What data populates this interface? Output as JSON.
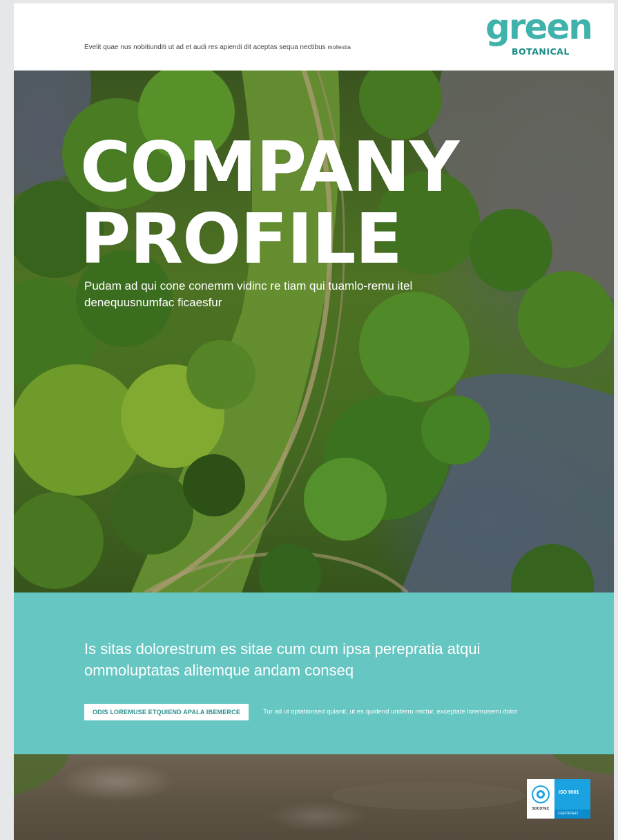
{
  "header": {
    "tagline_main": "Evelit quae nus nobitiunditi ut ad et audi res apiendi dit aceptas sequa nectibus",
    "tagline_small": "mollestia",
    "logo_word": "green",
    "logo_sub": "BOTANICAL"
  },
  "hero": {
    "title_line1": "COMPANY",
    "title_line2": "PROFILE",
    "subtitle": "Pudam ad qui cone conemm vidinc re tiam qui tuamlo-remu itel denequusnumfac ficaesfur"
  },
  "band": {
    "text": "Is sitas dolorestrum es sitae cum cum ipsa perepratia atqui ommoluptatas alitemque andam conseq",
    "button_label": "ODIS LOREMUSE ETQUIEND APALA IBEMERCE",
    "note": "Tur ad ut optationsed quianit, ut es quidend underro reictur, exceptate loremusemi dolor"
  },
  "certification": {
    "standard": "ISO 9001",
    "status": "CERTIFIED",
    "issuer": "SOCOTEC"
  },
  "colors": {
    "brand_teal": "#65c6c2",
    "logo_teal": "#3fb2ac",
    "cert_blue": "#1aa3e0"
  }
}
